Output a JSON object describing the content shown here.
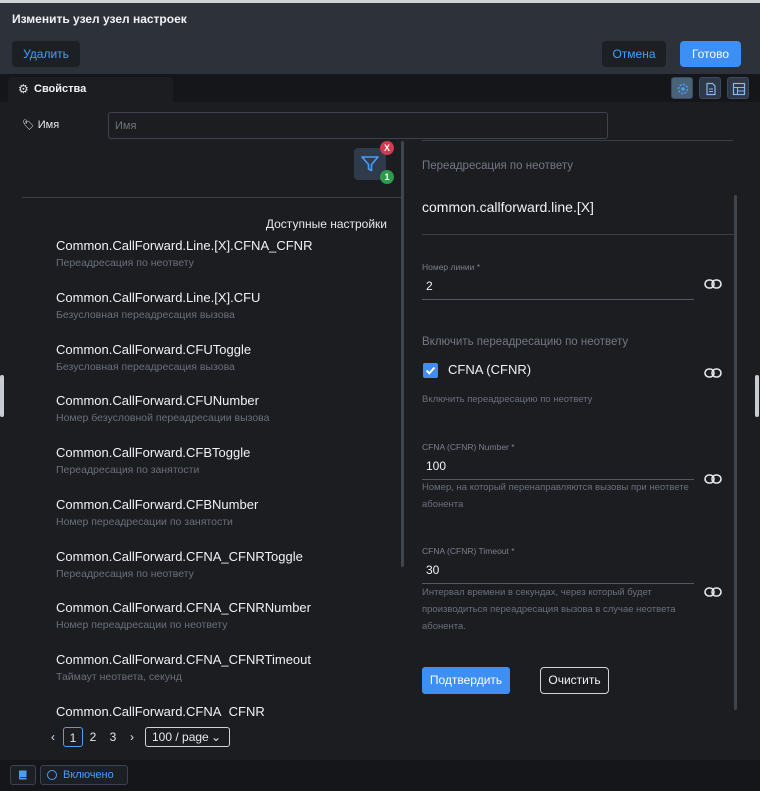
{
  "window": {
    "title": "Изменить узел узел настроек"
  },
  "actions": {
    "delete_label": "Удалить",
    "cancel_label": "Отмена",
    "done_label": "Готово"
  },
  "tabs": {
    "properties_label": "Свойства"
  },
  "name_field": {
    "label": "Имя",
    "placeholder": "Имя",
    "value": ""
  },
  "filter": {
    "clear_badge": "X",
    "count_badge": "1"
  },
  "available": {
    "title": "Доступные настройки",
    "items": [
      {
        "title": "Common.CallForward.Line.[X].CFNA_CFNR",
        "desc": "Переадресация по неответу"
      },
      {
        "title": "Common.CallForward.Line.[X].CFU",
        "desc": "Безусловная переадресация вызова"
      },
      {
        "title": "Common.CallForward.CFUToggle",
        "desc": "Безусловная переадресация вызова"
      },
      {
        "title": "Common.CallForward.CFUNumber",
        "desc": "Номер безусловной переадресации вызова"
      },
      {
        "title": "Common.CallForward.CFBToggle",
        "desc": "Переадресация по занятости"
      },
      {
        "title": "Common.CallForward.CFBNumber",
        "desc": "Номер переадресации по занятости"
      },
      {
        "title": "Common.CallForward.CFNA_CFNRToggle",
        "desc": "Переадресация по неответу"
      },
      {
        "title": "Common.CallForward.CFNA_CFNRNumber",
        "desc": "Номер переадресации по неответу"
      },
      {
        "title": "Common.CallForward.CFNA_CFNRTimeout",
        "desc": "Таймаут неответа, секунд"
      },
      {
        "title": "Common.CallForward.CFNA_CFNR",
        "desc": ""
      }
    ]
  },
  "pagination": {
    "pages": [
      "1",
      "2",
      "3"
    ],
    "current": "1",
    "page_size": "100 / page"
  },
  "detail": {
    "section_heading": "Переадресация по неответу",
    "node_title": "common.callforward.line.[X]",
    "line_number": {
      "label": "Номер линии *",
      "value": "2"
    },
    "enable_heading": "Включить переадресацию по неответу",
    "checkbox": {
      "label": "CFNA (CFNR)",
      "checked": true,
      "help": "Включить переадресацию по неответу"
    },
    "cfna_number": {
      "label": "CFNA (CFNR) Number *",
      "value": "100",
      "help": "Номер, на который перенаправляются вызовы при неответе абонента"
    },
    "cfna_timeout": {
      "label": "CFNA (CFNR) Timeout *",
      "value": "30",
      "help": "Интервал времени в секундах, через который будет производиться переадресация вызова в случае неответа абонента."
    },
    "confirm_label": "Подтвердить",
    "clear_label": "Очистить"
  },
  "footer": {
    "status_label": "Включено"
  },
  "colors": {
    "accent": "#3d8ef5",
    "link": "#4a9dff",
    "danger_badge": "#d23a50",
    "ok_badge": "#2f9a4a",
    "background": "#1b1d21"
  }
}
